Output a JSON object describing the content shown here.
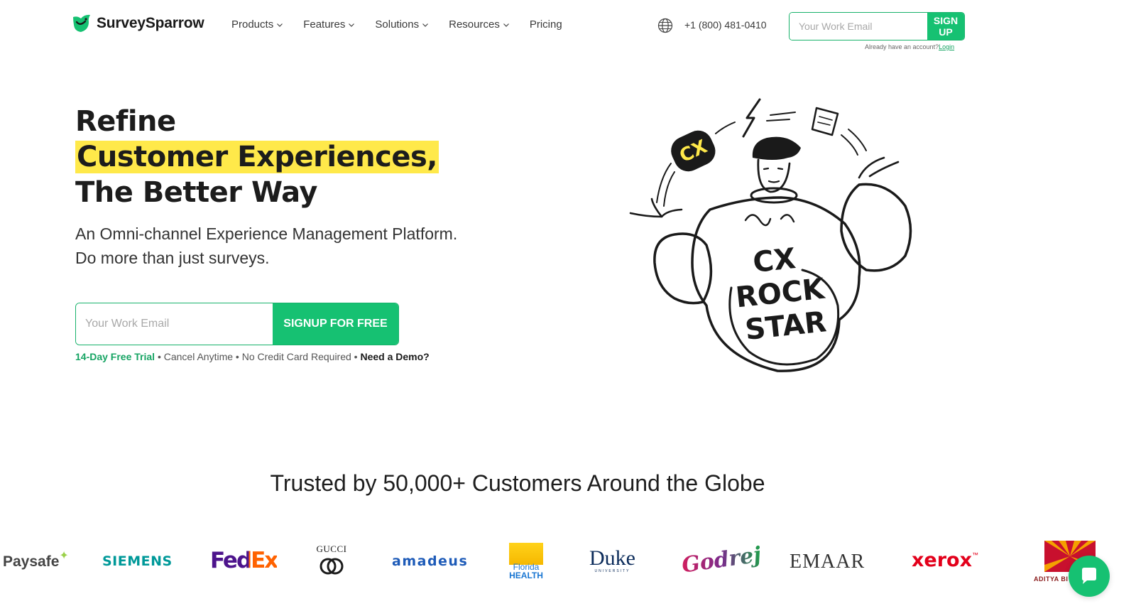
{
  "brand": {
    "name": "SurveySparrow",
    "accent": "#16c172",
    "highlight": "#ffe94a"
  },
  "nav": {
    "items": [
      {
        "label": "Products",
        "dropdown": true
      },
      {
        "label": "Features",
        "dropdown": true
      },
      {
        "label": "Solutions",
        "dropdown": true
      },
      {
        "label": "Resources",
        "dropdown": true
      },
      {
        "label": "Pricing",
        "dropdown": false
      }
    ],
    "globe_icon": "globe-icon",
    "phone": "+1 (800) 481-0410",
    "email_placeholder": "Your Work Email",
    "signup_label": "SIGN UP",
    "already_text": "Already have an account?",
    "login_label": "Login"
  },
  "hero": {
    "title_line1": "Refine",
    "title_line2": "Customer Experiences,",
    "title_line3": "The Better Way",
    "subtitle_line1": "An Omni-channel Experience Management Platform.",
    "subtitle_line2": "Do more than just surveys.",
    "email_placeholder": "Your Work Email",
    "cta_label": "SIGNUP FOR FREE",
    "perk_trial": "14-Day Free Trial",
    "perk_cancel": "Cancel Anytime",
    "perk_card": "No Credit Card Required",
    "perk_demo": "Need a Demo?",
    "separator": " • "
  },
  "illustration": {
    "badge": "CX",
    "body_line1": "CX",
    "body_line2": "ROCK",
    "body_line3": "STAR"
  },
  "trusted": {
    "heading": "Trusted by 50,000+ Customers Around the Globe",
    "logos": [
      "Paysafe",
      "SIEMENS",
      "FedEx",
      "GUCCI",
      "amadeus",
      "Florida HEALTH",
      "Duke",
      "Godrej",
      "EMAAR",
      "xerox",
      "ADITYA BI"
    ],
    "duke_sub": "UNIVERSITY",
    "florida_line1": "Florida",
    "florida_line2": "HEALTH",
    "xerox_tm": "™"
  },
  "chat": {
    "icon": "chat-bubble-icon"
  }
}
